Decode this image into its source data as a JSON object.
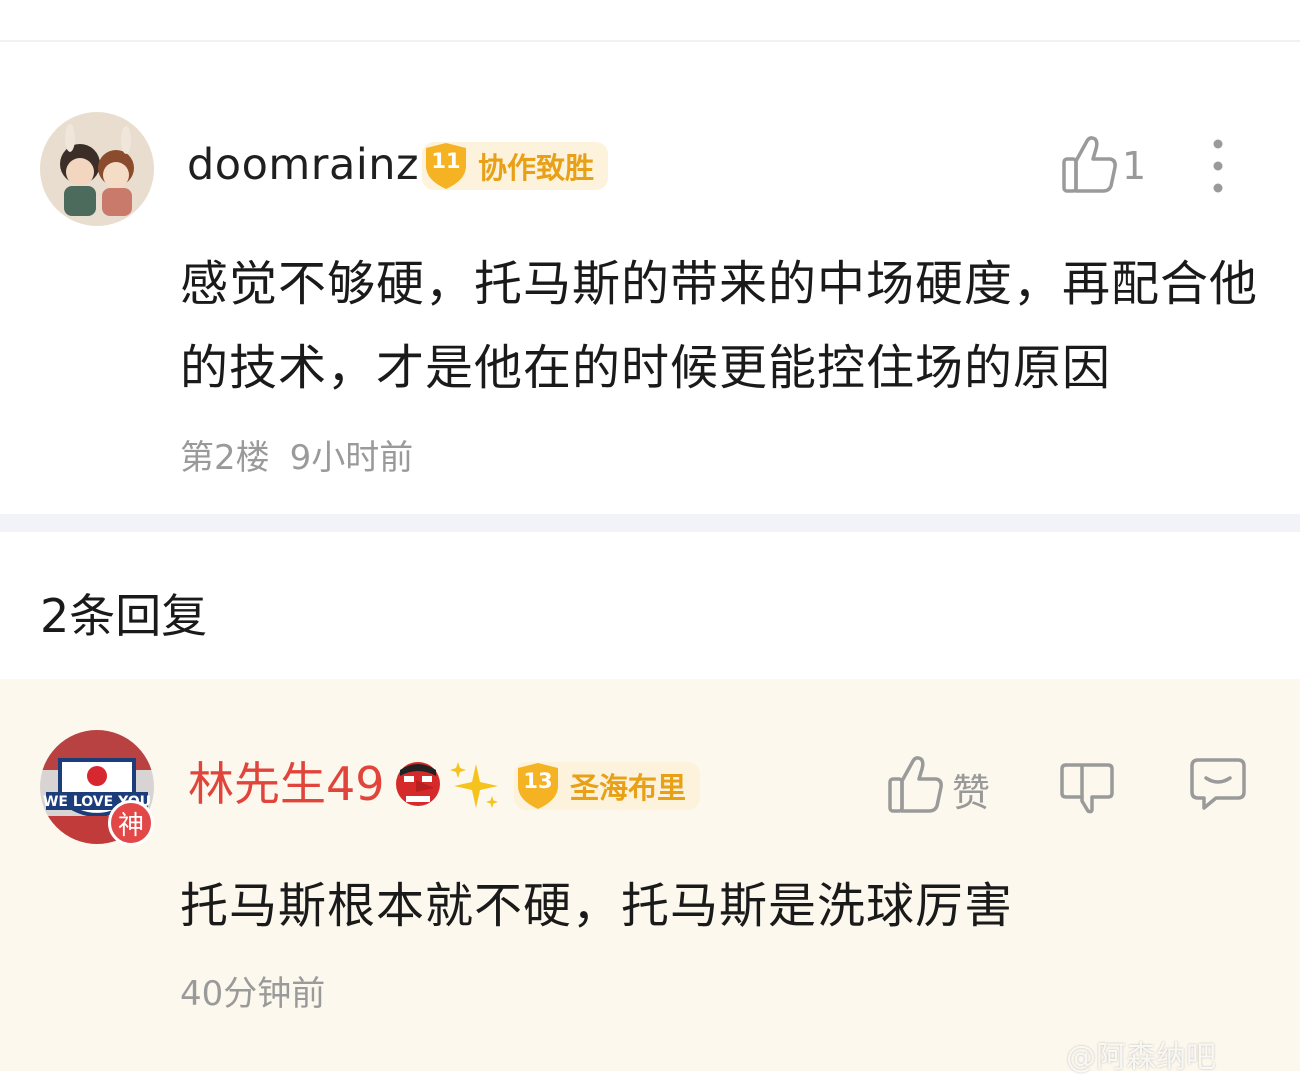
{
  "main_comment": {
    "username": "doomrainz",
    "level": "11",
    "level_title": "协作致胜",
    "like_count": "1",
    "content": "感觉不够硬，托马斯的带来的中场硬度，再配合他的技术，才是他在的时候更能控住场的原因",
    "floor": "第2楼",
    "time": "9小时前"
  },
  "replies_header": "2条回复",
  "reply": {
    "username": "林先生49",
    "avatar_badge": "神",
    "level": "13",
    "level_title": "圣海布里",
    "like_label": "赞",
    "content": "托马斯根本就不硬，托马斯是洗球厉害",
    "time": "40分钟前"
  },
  "watermark": "@阿森纳吧",
  "colors": {
    "accent_gold": "#e8a017",
    "level_bg": "#fdf3dc",
    "reply_name": "#e0443a",
    "reply_bg": "#fcf8ed",
    "meta_gray": "#9a9a9a"
  }
}
